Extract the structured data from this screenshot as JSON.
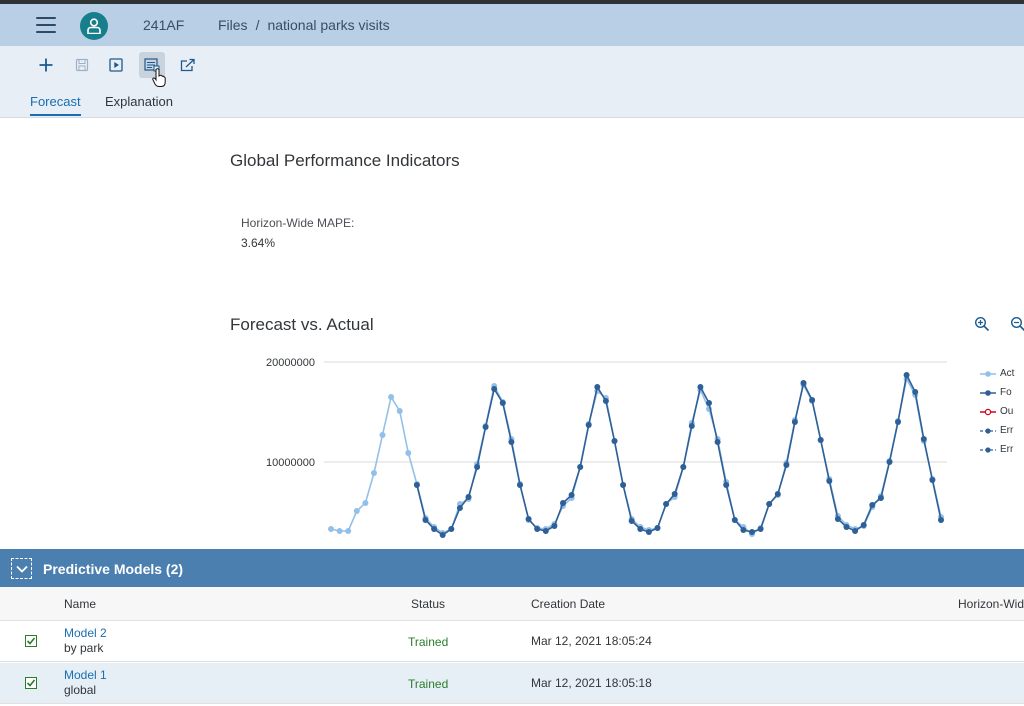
{
  "shell": {
    "app_id": "241AF",
    "breadcrumb": {
      "parent": "Files",
      "separator": "/",
      "current": "national parks visits"
    }
  },
  "toolbar": {
    "icons": [
      "add-icon",
      "save-icon",
      "run-icon",
      "report-icon",
      "export-icon"
    ],
    "active_icon": "report-icon"
  },
  "tabs": [
    {
      "label": "Forecast",
      "selected": true
    },
    {
      "label": "Explanation",
      "selected": false
    }
  ],
  "global_indicators": {
    "title": "Global Performance Indicators",
    "mape_label": "Horizon-Wide MAPE:",
    "mape_value": "3.64%"
  },
  "chart_section": {
    "title": "Forecast vs. Actual"
  },
  "chart_data": {
    "type": "line",
    "title": "Forecast vs. Actual",
    "x": [
      1,
      2,
      3,
      4,
      5,
      6,
      7,
      8,
      9,
      10,
      11,
      12,
      13,
      14,
      15,
      16,
      17,
      18,
      19,
      20,
      21,
      22,
      23,
      24,
      25,
      26,
      27,
      28,
      29,
      30,
      31,
      32,
      33,
      34,
      35,
      36,
      37,
      38,
      39,
      40,
      41,
      42,
      43,
      44,
      45,
      46,
      47,
      48,
      49,
      50,
      51,
      52,
      53,
      54,
      55,
      56,
      57,
      58,
      59,
      60,
      61,
      62,
      63,
      64,
      65,
      66,
      67,
      68,
      69,
      70,
      71,
      72
    ],
    "yticks": [
      10000000,
      20000000
    ],
    "ytick_labels": [
      "10000000",
      "20000000"
    ],
    "ylim": [
      2000000,
      20500000
    ],
    "colors": {
      "actual": "#93c0e8",
      "forecast": "#2e5f96",
      "outlier": "#d0021b",
      "error": "#2e5f96"
    },
    "series": [
      {
        "name": "Actual",
        "values": [
          3300000,
          3100000,
          3100000,
          5100000,
          5900000,
          8900000,
          12700000,
          16500000,
          15100000,
          10900000,
          7800000,
          4400000,
          3500000,
          2900000,
          3300000,
          5800000,
          6300000,
          9800000,
          13600000,
          17600000,
          16000000,
          12300000,
          7800000,
          4200000,
          3400000,
          3300000,
          3800000,
          5600000,
          6400000,
          9500000,
          13800000,
          17100000,
          16400000,
          12100000,
          7700000,
          4300000,
          3500000,
          3200000,
          3400000,
          5800000,
          6500000,
          9500000,
          13900000,
          17200000,
          15300000,
          12300000,
          8000000,
          4200000,
          3500000,
          2800000,
          3400000,
          5800000,
          6700000,
          9900000,
          14200000,
          17700000,
          16100000,
          12200000,
          8300000,
          4600000,
          3700000,
          3300000,
          3600000,
          5500000,
          6600000,
          10100000,
          14100000,
          18300000,
          16700000,
          12100000,
          8300000,
          4500000
        ]
      },
      {
        "name": "Forecast",
        "values": [
          null,
          null,
          null,
          null,
          null,
          null,
          null,
          null,
          null,
          null,
          7700000,
          4200000,
          3300000,
          2700000,
          3300000,
          5400000,
          6500000,
          9500000,
          13500000,
          17300000,
          15900000,
          12000000,
          7700000,
          4300000,
          3300000,
          3100000,
          3600000,
          5900000,
          6700000,
          9500000,
          13700000,
          17500000,
          16100000,
          12100000,
          7700000,
          4100000,
          3300000,
          3000000,
          3400000,
          5800000,
          6800000,
          9500000,
          13600000,
          17500000,
          15900000,
          12000000,
          7700000,
          4200000,
          3200000,
          3000000,
          3300000,
          5800000,
          6800000,
          9700000,
          14000000,
          17900000,
          16200000,
          12200000,
          8100000,
          4300000,
          3500000,
          3100000,
          3700000,
          5700000,
          6400000,
          10000000,
          14000000,
          18700000,
          17000000,
          12300000,
          8200000,
          4200000
        ]
      },
      {
        "name": "Outliers",
        "values": []
      },
      {
        "name": "Error Min",
        "values": []
      },
      {
        "name": "Error Max",
        "values": []
      }
    ],
    "legend_labels": [
      "Act",
      "Fo",
      "Ou",
      "Err",
      "Err"
    ],
    "legend_position": "right",
    "grid": true
  },
  "models_panel": {
    "title": "Predictive Models (2)",
    "columns": [
      "Name",
      "Status",
      "Creation Date",
      "Horizon-Wid"
    ],
    "rows": [
      {
        "name": "Model 2",
        "subtitle": "by park",
        "status": "Trained",
        "created": "Mar 12, 2021 18:05:24",
        "checked": true,
        "selected": false
      },
      {
        "name": "Model 1",
        "subtitle": "global",
        "status": "Trained",
        "created": "Mar 12, 2021 18:05:18",
        "checked": true,
        "selected": true
      }
    ]
  }
}
